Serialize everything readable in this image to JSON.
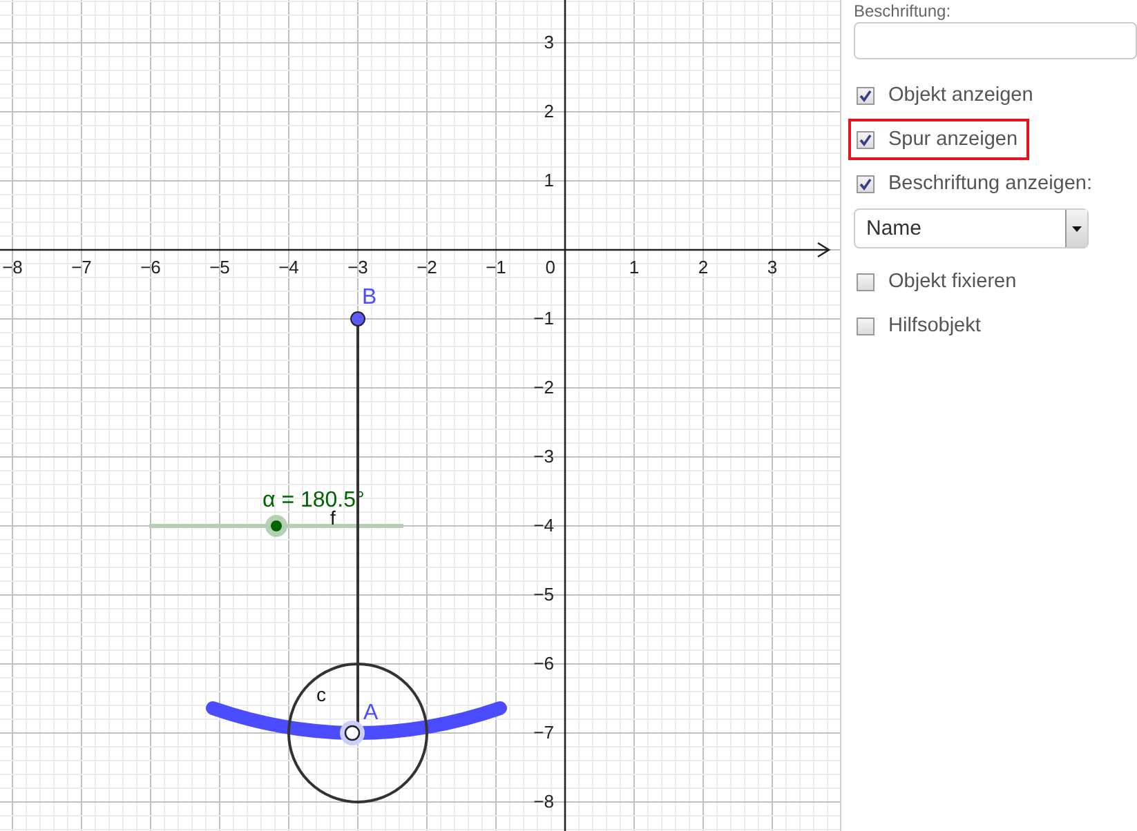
{
  "graphics": {
    "x_labels": [
      "−8",
      "−7",
      "−6",
      "−5",
      "−4",
      "−3",
      "−2",
      "−1",
      "1",
      "2",
      "3"
    ],
    "origin_label": "0",
    "y_labels": [
      "3",
      "2",
      "1",
      "−1",
      "−2",
      "−3",
      "−4",
      "−5",
      "−6",
      "−7",
      "−8"
    ],
    "slider": {
      "label": "α = 180.5°",
      "level": 0.5
    },
    "segment_label": "f",
    "circle_label": "c",
    "point_labels": [
      "B",
      "A"
    ]
  },
  "properties": {
    "caption_label": "Beschriftung:",
    "options": [
      {
        "kind": "checkbox",
        "label": "Objekt anzeigen",
        "checked": true,
        "highlighted": false
      },
      {
        "kind": "checkbox",
        "label": "Spur anzeigen",
        "checked": true,
        "highlighted": true
      },
      {
        "kind": "checkbox",
        "label": "Beschriftung anzeigen:",
        "checked": true,
        "highlighted": false
      },
      {
        "kind": "dropdown",
        "value": "Name"
      },
      {
        "kind": "checkbox",
        "label": "Objekt fixieren",
        "checked": false,
        "highlighted": false
      },
      {
        "kind": "checkbox",
        "label": "Hilfsobjekt",
        "checked": false,
        "highlighted": false
      }
    ]
  }
}
